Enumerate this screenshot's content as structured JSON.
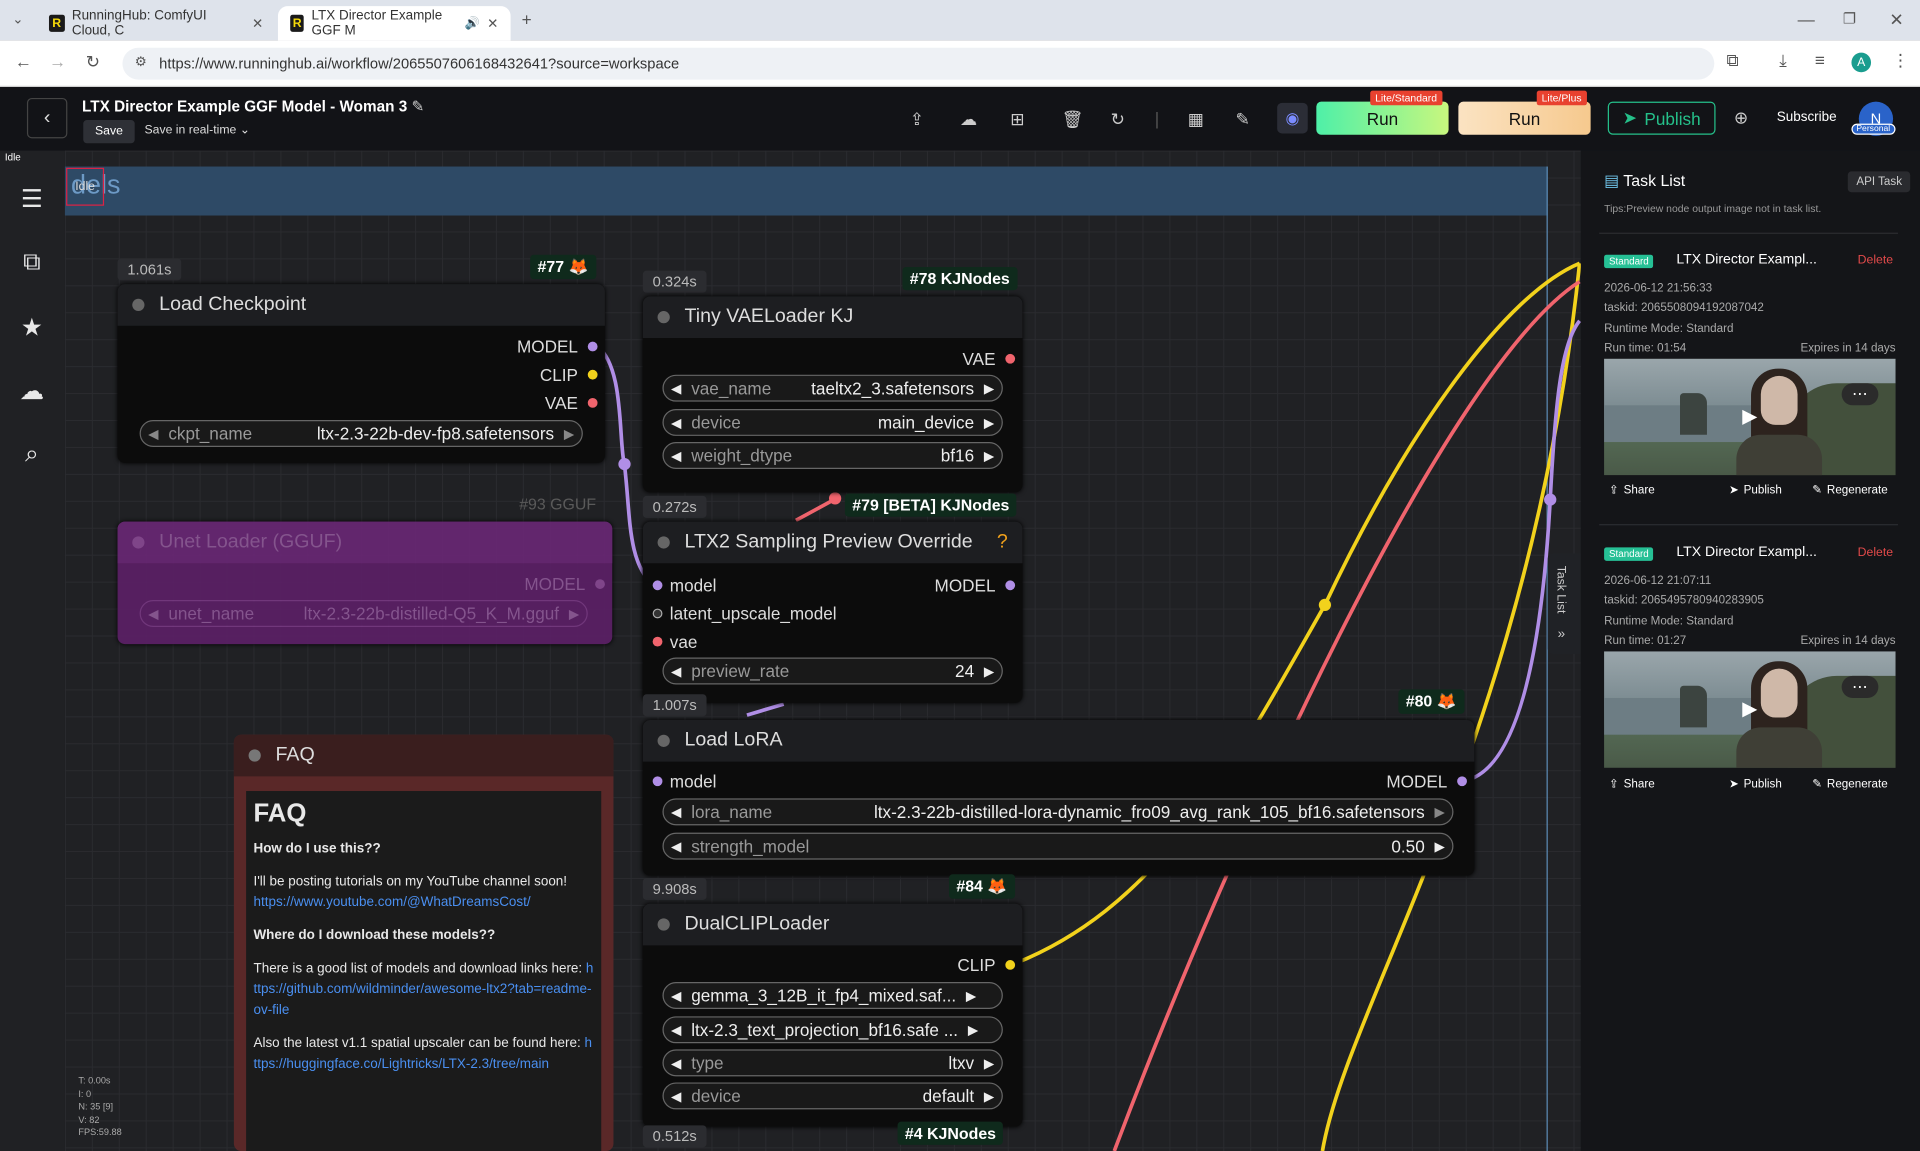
{
  "browser": {
    "tabs": [
      {
        "title": "RunningHub: ComfyUI Cloud, C"
      },
      {
        "title": "LTX Director Example GGF M"
      }
    ],
    "url": "https://www.runninghub.ai/workflow/2065507606168432641?source=workspace",
    "profile_initial": "A"
  },
  "app": {
    "title": "LTX Director Example GGF Model - Woman 3",
    "save_label": "Save",
    "save_mode": "Save in real-time",
    "run_standard": {
      "label": "Run",
      "badge": "Lite/Standard"
    },
    "run_plus": {
      "label": "Run",
      "badge": "Lite/Plus"
    },
    "publish_label": "Publish",
    "subscribe_label": "Subscribe",
    "avatar_initial": "N",
    "avatar_badge": "Personal",
    "status_top": "Idle",
    "colors": {
      "run_green": "#4ef0a8",
      "publish_green": "#25c08a",
      "delete_red": "#e34a4a"
    }
  },
  "sidebar": {
    "icons": [
      "document-icon",
      "network-icon",
      "star-icon",
      "cloud-icon",
      "chat-search-icon"
    ]
  },
  "canvas": {
    "group_title": "dels",
    "idle_box": "Idle",
    "nodes": {
      "load_checkpoint": {
        "time": "1.061s",
        "badge": "#77 🦊",
        "title": "Load Checkpoint",
        "outputs": [
          "MODEL",
          "CLIP",
          "VAE"
        ],
        "widget": {
          "name": "ckpt_name",
          "value": "ltx-2.3-22b-dev-fp8.safetensors"
        }
      },
      "tiny_vae": {
        "time": "0.324s",
        "badge": "#78 KJNodes",
        "title": "Tiny VAELoader KJ",
        "output": "VAE",
        "widgets": [
          {
            "name": "vae_name",
            "value": "taeltx2_3.safetensors"
          },
          {
            "name": "device",
            "value": "main_device"
          },
          {
            "name": "weight_dtype",
            "value": "bf16"
          }
        ]
      },
      "unet_loader": {
        "badge": "#93 GGUF",
        "title": "Unet Loader (GGUF)",
        "output": "MODEL",
        "widget": {
          "name": "unet_name",
          "value": "ltx-2.3-22b-distilled-Q5_K_M.gguf"
        }
      },
      "ltx2_preview": {
        "time": "0.272s",
        "badge": "#79 [BETA] KJNodes",
        "title": "LTX2 Sampling Preview Override",
        "help": "?",
        "inputs": [
          "model",
          "latent_upscale_model",
          "vae"
        ],
        "output": "MODEL",
        "widget": {
          "name": "preview_rate",
          "value": "24"
        }
      },
      "load_lora": {
        "time": "1.007s",
        "badge": "#80 🦊",
        "title": "Load LoRA",
        "input": "model",
        "output": "MODEL",
        "widgets": [
          {
            "name": "lora_name",
            "value": "ltx-2.3-22b-distilled-lora-dynamic_fro09_avg_rank_105_bf16.safetensors"
          },
          {
            "name": "strength_model",
            "value": "0.50"
          }
        ]
      },
      "dual_clip": {
        "time": "9.908s",
        "badge": "#84 🦊",
        "title": "DualCLIPLoader",
        "output": "CLIP",
        "widgets": [
          {
            "name": "",
            "value": "gemma_3_12B_it_fp4_mixed.saf..."
          },
          {
            "name": "",
            "value": "ltx-2.3_text_projection_bf16.safe ..."
          },
          {
            "name": "type",
            "value": "ltxv"
          },
          {
            "name": "device",
            "value": "default"
          }
        ]
      },
      "bottom_node": {
        "time": "0.512s",
        "badge": "#4 KJNodes"
      }
    },
    "faq": {
      "title": "FAQ",
      "heading": "FAQ",
      "q1": "How do I use this??",
      "a1": "I'll be posting tutorials on my YouTube channel soon!",
      "link1": "https://www.youtube.com/@WhatDreamsCost/",
      "q2": "Where do I download these models??",
      "a2": "There is a good list of models and download links here:",
      "link2": "https://github.com/wildminder/awesome-ltx2?tab=readme-ov-file",
      "a3": "Also the latest v1.1 spatial upscaler can be found here:",
      "link3": "https://huggingface.co/Lightricks/LTX-2.3/tree/main"
    },
    "stats": [
      "T: 0.00s",
      "I: 0",
      "N: 35 [9]",
      "V: 82",
      "FPS:59.88"
    ]
  },
  "task_panel": {
    "title": "Task List",
    "api_button": "API Task",
    "tips": "Tips:Preview node output image not in task list.",
    "handle_label": "Task List",
    "tasks": [
      {
        "badge": "Standard",
        "name": "LTX Director Exampl...",
        "delete": "Delete",
        "date": "2026-06-12 21:56:33",
        "taskid": "taskid: 2065508094192087042",
        "mode": "Runtime Mode: Standard",
        "runtime": "Run time: 01:54",
        "expires": "Expires in 14 days",
        "actions": [
          "Share",
          "Publish",
          "Regenerate"
        ]
      },
      {
        "badge": "Standard",
        "name": "LTX Director Exampl...",
        "delete": "Delete",
        "date": "2026-06-12 21:07:11",
        "taskid": "taskid: 2065495780940283905",
        "mode": "Runtime Mode: Standard",
        "runtime": "Run time: 01:27",
        "expires": "Expires in 14 days",
        "actions": [
          "Share",
          "Publish",
          "Regenerate"
        ]
      }
    ]
  }
}
